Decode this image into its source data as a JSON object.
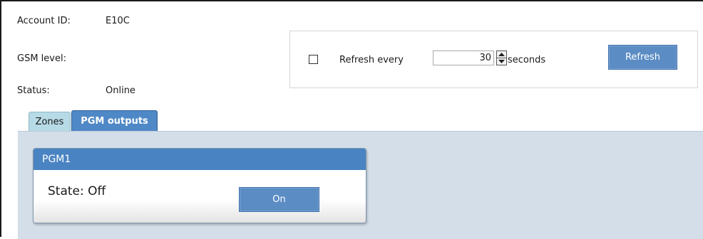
{
  "account": {
    "id_label": "Account ID:",
    "id_value": "E10C",
    "gsm_label": "GSM level:",
    "gsm_value": "",
    "status_label": "Status:",
    "status_value": "Online"
  },
  "refresh": {
    "checkbox_checked": false,
    "label": "Refresh every",
    "interval_value": "30",
    "unit_label": "seconds",
    "button_label": "Refresh"
  },
  "tabs": [
    {
      "label": "Zones",
      "active": false
    },
    {
      "label": "PGM outputs",
      "active": true
    }
  ],
  "pgm_outputs": [
    {
      "name": "PGM1",
      "state_text": "State: Off",
      "button_label": "On"
    }
  ],
  "icons": {
    "spin_up": "chevron-up-icon",
    "spin_down": "chevron-down-icon"
  },
  "colors": {
    "accent_blue": "#4a83c2",
    "button_blue": "#5b8cc4",
    "inactive_tab": "#b7dbe6",
    "panel_background": "#d3dee9"
  }
}
